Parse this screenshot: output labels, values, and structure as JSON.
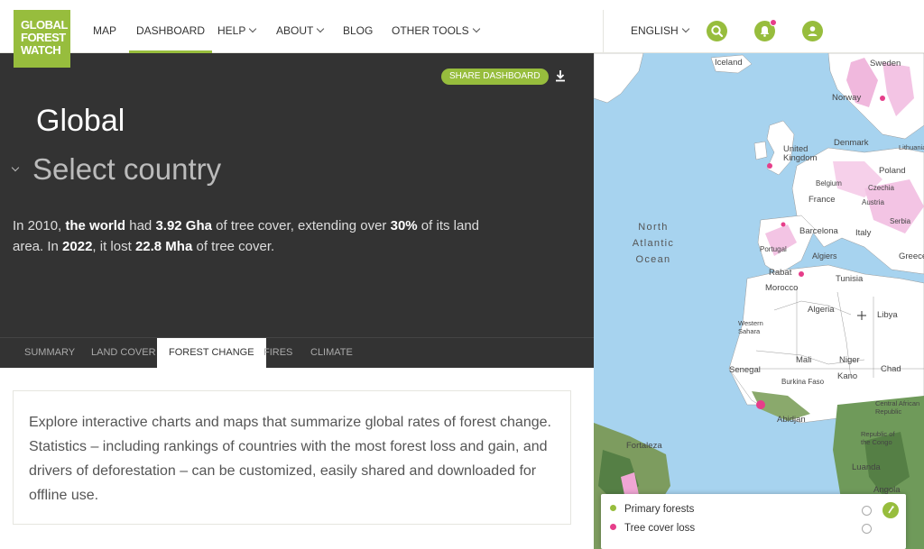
{
  "nav": {
    "logo_lines": [
      "GLOBAL",
      "FOREST",
      "WATCH"
    ],
    "items": [
      {
        "label": "MAP",
        "active": false,
        "dropdown": false
      },
      {
        "label": "DASHBOARD",
        "active": true,
        "dropdown": false
      },
      {
        "label": "HELP",
        "active": false,
        "dropdown": true
      },
      {
        "label": "ABOUT",
        "active": false,
        "dropdown": true
      },
      {
        "label": "BLOG",
        "active": false,
        "dropdown": false
      },
      {
        "label": "OTHER TOOLS",
        "active": false,
        "dropdown": true
      }
    ],
    "language": "ENGLISH",
    "icons": [
      "search-icon",
      "bell-icon",
      "user-icon"
    ]
  },
  "header": {
    "share_label": "SHARE DASHBOARD",
    "title": "Global",
    "select_label": "Select country",
    "summary": {
      "p1": "In 2010, ",
      "b1": "the world",
      "p2": " had ",
      "b2": "3.92 Gha",
      "p3": " of tree cover, extending over ",
      "b3": "30%",
      "p4": " of its land area. In ",
      "b4": "2022",
      "p5": ", it lost ",
      "b5": "22.8 Mha",
      "p6": " of tree cover."
    }
  },
  "tabs": [
    {
      "label": "SUMMARY",
      "active": false
    },
    {
      "label": "LAND COVER",
      "active": false
    },
    {
      "label": "FOREST CHANGE",
      "active": true
    },
    {
      "label": "FIRES",
      "active": false
    },
    {
      "label": "CLIMATE",
      "active": false
    }
  ],
  "intro": "Explore interactive charts and maps that summarize global rates of forest change. Statistics – including rankings of countries with the most forest loss and gain, and drivers of deforestation – can be customized, easily shared and downloaded for offline use.",
  "map": {
    "labels": [
      "Iceland",
      "Sweden",
      "Norway",
      "Denmark",
      "United Kingdom",
      "Belgium",
      "Poland",
      "Czechia",
      "France",
      "Austria",
      "Serbia",
      "Italy",
      "Barcelona",
      "Portugal",
      "Algiers",
      "Greece",
      "Tunisia",
      "Rabat",
      "Morocco",
      "Algeria",
      "Libya",
      "Western Sahara",
      "Mali",
      "Niger",
      "Chad",
      "Senegal",
      "Burkina Faso",
      "Kano",
      "Abidjan",
      "Central African Republic",
      "Republic of the Congo",
      "Luanda",
      "Angola",
      "Fortaleza",
      "Lithuania"
    ],
    "ocean": [
      "North",
      "Atlantic",
      "Ocean"
    ]
  },
  "legend": [
    {
      "label": "Primary forests",
      "color": "#97bd3d"
    },
    {
      "label": "Tree cover loss",
      "color": "#e63e8a"
    }
  ],
  "colors": {
    "accent": "#97bd3d",
    "dark_bg": "#333333",
    "loss": "#e63e8a",
    "water": "#a7d3ef"
  }
}
